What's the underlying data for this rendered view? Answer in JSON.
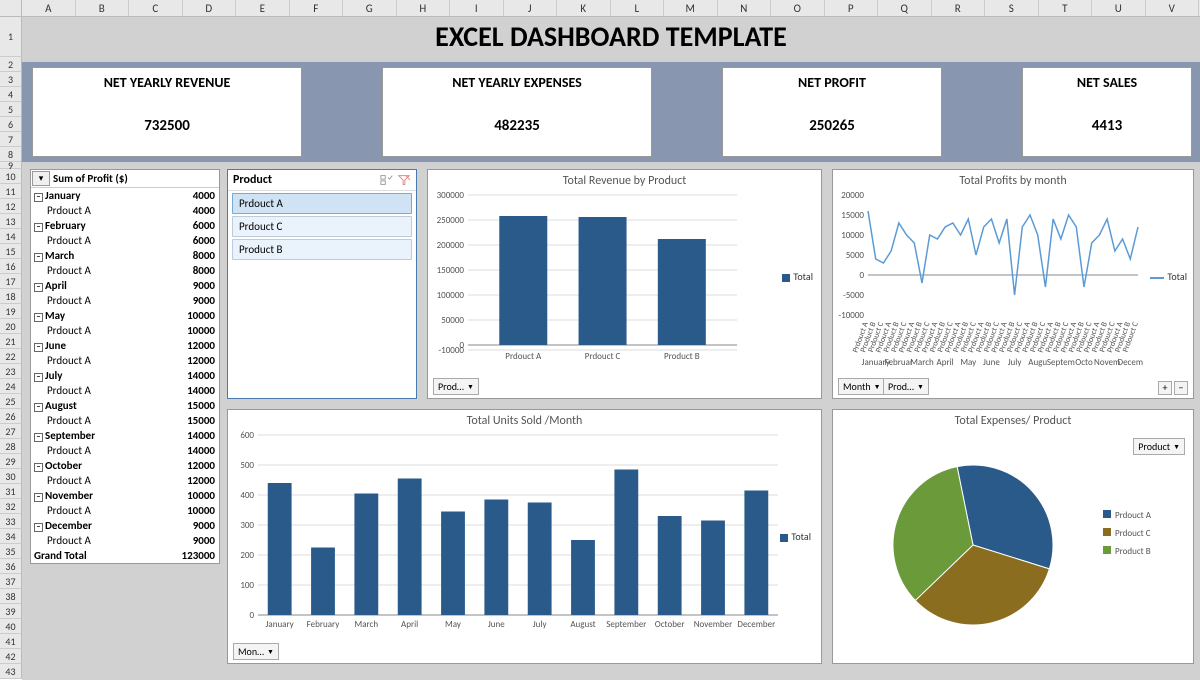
{
  "title": "EXCEL DASHBOARD TEMPLATE",
  "columns": [
    "A",
    "B",
    "C",
    "D",
    "E",
    "F",
    "G",
    "H",
    "I",
    "J",
    "K",
    "L",
    "M",
    "N",
    "O",
    "P",
    "Q",
    "R",
    "S",
    "T",
    "U",
    "V"
  ],
  "kpi": [
    {
      "label": "NET YEARLY REVENUE",
      "value": "732500"
    },
    {
      "label": "NET YEARLY EXPENSES",
      "value": "482235"
    },
    {
      "label": "NET PROFIT",
      "value": "250265"
    },
    {
      "label": "NET SALES",
      "value": "4413"
    }
  ],
  "pivot": {
    "header": "Sum of Profit ($)",
    "rows": [
      {
        "m": "January",
        "v": "4000",
        "s": "Prdouct A",
        "sv": "4000"
      },
      {
        "m": "February",
        "v": "6000",
        "s": "Prdouct A",
        "sv": "6000"
      },
      {
        "m": "March",
        "v": "8000",
        "s": "Prdouct A",
        "sv": "8000"
      },
      {
        "m": "April",
        "v": "9000",
        "s": "Prdouct A",
        "sv": "9000"
      },
      {
        "m": "May",
        "v": "10000",
        "s": "Prdouct A",
        "sv": "10000"
      },
      {
        "m": "June",
        "v": "12000",
        "s": "Prdouct A",
        "sv": "12000"
      },
      {
        "m": "July",
        "v": "14000",
        "s": "Prdouct A",
        "sv": "14000"
      },
      {
        "m": "August",
        "v": "15000",
        "s": "Prdouct A",
        "sv": "15000"
      },
      {
        "m": "September",
        "v": "14000",
        "s": "Prdouct A",
        "sv": "14000"
      },
      {
        "m": "October",
        "v": "12000",
        "s": "Prdouct A",
        "sv": "12000"
      },
      {
        "m": "November",
        "v": "10000",
        "s": "Prdouct A",
        "sv": "10000"
      },
      {
        "m": "December",
        "v": "9000",
        "s": "Prdouct A",
        "sv": "9000"
      }
    ],
    "grand_label": "Grand Total",
    "grand_value": "123000"
  },
  "slicer": {
    "title": "Product",
    "items": [
      "Prdouct A",
      "Prdouct C",
      "Product B"
    ],
    "selected": 0
  },
  "chart_data": [
    {
      "id": "revenue",
      "type": "bar",
      "title": "Total Revenue by Product",
      "categories": [
        "Prdouct A",
        "Prdouct C",
        "Product B"
      ],
      "values": [
        258000,
        256000,
        212000
      ],
      "ylim": [
        -10000,
        300000
      ],
      "yticks": [
        -10000,
        0,
        50000,
        100000,
        150000,
        200000,
        250000,
        300000
      ],
      "legend": "Total",
      "filter": "Prod…"
    },
    {
      "id": "profits",
      "type": "line",
      "title": "Total Profits by month",
      "categories": [
        "January",
        "February",
        "March",
        "April",
        "May",
        "June",
        "July",
        "August",
        "September",
        "October",
        "November",
        "December"
      ],
      "subcats": [
        "Prdouct A",
        "Product B",
        "Prdouct C"
      ],
      "values": [
        16000,
        4000,
        3000,
        6000,
        13000,
        10000,
        8000,
        -2000,
        10000,
        9000,
        12000,
        13000,
        10000,
        14000,
        5000,
        12000,
        14000,
        8000,
        14000,
        -5000,
        12000,
        15000,
        10000,
        -3000,
        14000,
        9000,
        15000,
        12000,
        -3000,
        8000,
        10000,
        14000,
        6000,
        9000,
        4000,
        12000
      ],
      "ylim": [
        -10000,
        20000
      ],
      "yticks": [
        -10000,
        -5000,
        0,
        5000,
        10000,
        15000,
        20000
      ],
      "legend": "Total",
      "filters": [
        "Month",
        "Prod…"
      ]
    },
    {
      "id": "units",
      "type": "bar",
      "title": "Total Units Sold /Month",
      "categories": [
        "January",
        "February",
        "March",
        "April",
        "May",
        "June",
        "July",
        "August",
        "September",
        "October",
        "November",
        "December"
      ],
      "values": [
        440,
        225,
        405,
        455,
        345,
        385,
        375,
        250,
        485,
        330,
        315,
        415
      ],
      "ylim": [
        0,
        600
      ],
      "yticks": [
        0,
        100,
        200,
        300,
        400,
        500,
        600
      ],
      "legend": "Total",
      "filter": "Mon…"
    },
    {
      "id": "expenses",
      "type": "pie",
      "title": "Total Expenses/ Product",
      "series": [
        {
          "name": "Prdouct A",
          "value": 33,
          "color": "#2a5a8a"
        },
        {
          "name": "Prdouct C",
          "value": 33,
          "color": "#8a6d1e"
        },
        {
          "name": "Product B",
          "value": 34,
          "color": "#6a9a3a"
        }
      ],
      "filter": "Product",
      "legend_title": "Product"
    }
  ]
}
